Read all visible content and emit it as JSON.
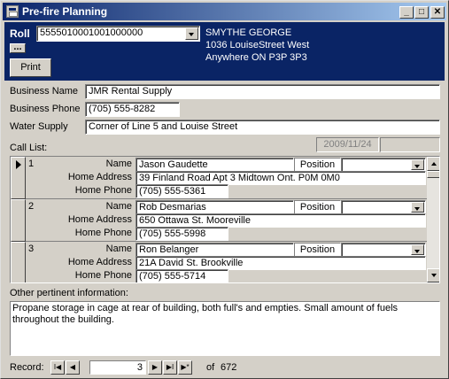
{
  "window": {
    "title": "Pre-fire Planning",
    "minimize_glyph": "_",
    "maximize_glyph": "□",
    "close_glyph": "✕"
  },
  "header": {
    "roll_label": "Roll",
    "roll_value": "5555010001001000000",
    "ellipsis_label": "...",
    "print_label": "Print",
    "owner_name": "SMYTHE GEORGE",
    "owner_address1": "1036 LouiseStreet West",
    "owner_address2": "Anywhere ON P3P 3P3"
  },
  "business": {
    "name_label": "Business Name",
    "name_value": "JMR Rental Supply",
    "phone_label": "Business Phone",
    "phone_value": "(705) 555-8282",
    "water_label": "Water Supply",
    "water_value": "Corner of Line 5 and Louise Street"
  },
  "call_list": {
    "label": "Call List:",
    "date": "2009/11/24",
    "name_label": "Name",
    "home_address_label": "Home Address",
    "home_phone_label": "Home Phone",
    "position_label": "Position",
    "records": [
      {
        "num": "1",
        "name": "Jason Gaudette",
        "address": "39 Finland Road Apt 3 Midtown Ont. P0M 0M0",
        "phone": "(705) 555-5361",
        "position": ""
      },
      {
        "num": "2",
        "name": "Rob Desmarias",
        "address": "650 Ottawa St. Mooreville",
        "phone": "(705) 555-5998",
        "position": ""
      },
      {
        "num": "3",
        "name": "Ron Belanger",
        "address": "21A David St. Brookville",
        "phone": "(705) 555-5714",
        "position": ""
      }
    ]
  },
  "other_info": {
    "label": "Other pertinent information:",
    "text": "Propane storage in cage at rear of building, both full's and empties. Small amount of fuels throughout the building."
  },
  "navigation": {
    "record_label": "Record:",
    "current": "3",
    "of_label": "of",
    "total": "672",
    "first_glyph": "I◀",
    "prev_glyph": "◀",
    "next_glyph": "▶",
    "last_glyph": "▶I",
    "new_glyph": "▶*"
  }
}
